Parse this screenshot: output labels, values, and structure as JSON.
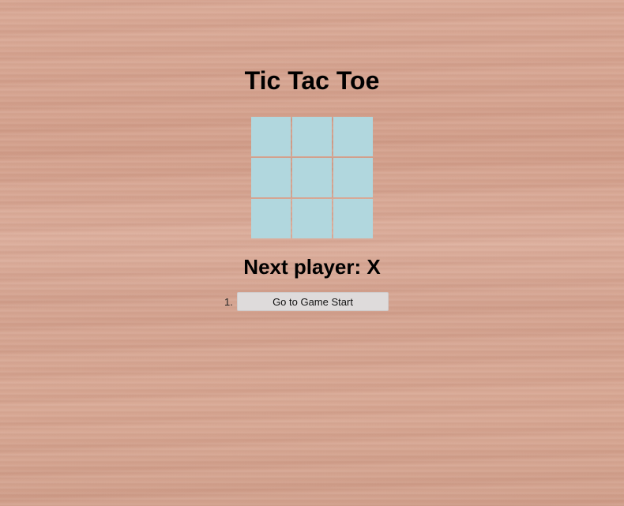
{
  "title": "Tic Tac Toe",
  "board": {
    "cells": [
      "",
      "",
      "",
      "",
      "",
      "",
      "",
      "",
      ""
    ],
    "cell_color": "#b1d7de"
  },
  "status": "Next player: X",
  "history": [
    {
      "number": "1.",
      "label": "Go to Game Start"
    }
  ]
}
